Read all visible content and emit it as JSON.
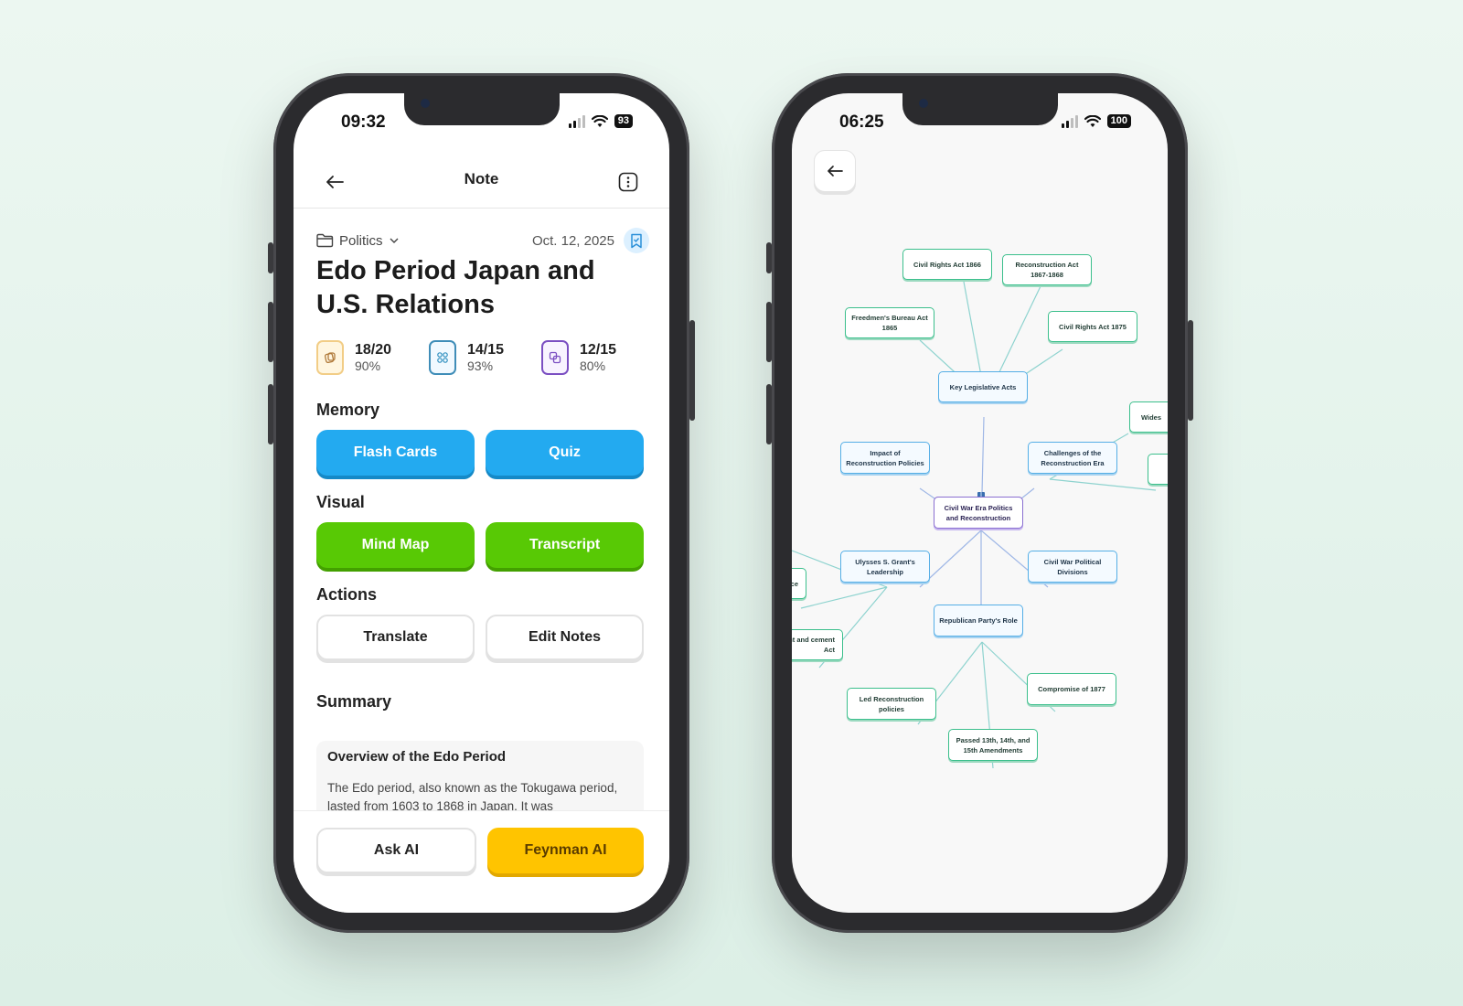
{
  "left_phone": {
    "status": {
      "time": "09:32",
      "battery": "93"
    },
    "header": {
      "title": "Note"
    },
    "meta": {
      "folder": "Politics",
      "date": "Oct. 12, 2025"
    },
    "note_title": "Edo Period Japan and U.S. Relations",
    "stats": [
      {
        "icon": "flash-card-icon",
        "score": "18/20",
        "percent": "90%",
        "color": "#f0c36a"
      },
      {
        "icon": "quiz-icon",
        "score": "14/15",
        "percent": "93%",
        "color": "#2f8fbf"
      },
      {
        "icon": "copy-cards-icon",
        "score": "12/15",
        "percent": "80%",
        "color": "#7b4fc2"
      }
    ],
    "sections": {
      "memory": {
        "label": "Memory",
        "buttons": [
          "Flash Cards",
          "Quiz"
        ]
      },
      "visual": {
        "label": "Visual",
        "buttons": [
          "Mind Map",
          "Transcript"
        ]
      },
      "actions": {
        "label": "Actions",
        "buttons": [
          "Translate",
          "Edit Notes"
        ]
      }
    },
    "summary": {
      "label": "Summary",
      "heading": "Overview of the Edo Period",
      "text": "The Edo period, also known as the Tokugawa period, lasted from 1603 to 1868 in Japan. It was"
    },
    "bottom": {
      "ask_ai": "Ask AI",
      "feynman_ai": "Feynman AI"
    }
  },
  "right_phone": {
    "status": {
      "time": "06:25",
      "battery": "100"
    },
    "mind_map": {
      "root": "Civil War Era Politics and Reconstruction",
      "nodes": {
        "key_acts": "Key Legislative Acts",
        "civil_rights_1866": "Civil Rights Act 1866",
        "reconstruction_act": "Reconstruction Act 1867-1868",
        "freedmens_bureau": "Freedmen's Bureau Act 1865",
        "civil_rights_1875": "Civil Rights Act 1875",
        "impact": "Impact of Reconstruction Policies",
        "challenges": "Challenges of the Reconstruction Era",
        "grant": "Ulysses S. Grant's Leadership",
        "divisions": "Civil War Political Divisions",
        "republican": "Republican Party's Role",
        "led_reconstruction": "Led Reconstruction policies",
        "compromise": "Compromise of 1877",
        "amendments": "Passed 13th, 14th, and 15th Amendments",
        "wides_partial": "Wides",
        "ce_partial": "ce",
        "enforcement_partial": "endment and cement Act"
      }
    }
  }
}
